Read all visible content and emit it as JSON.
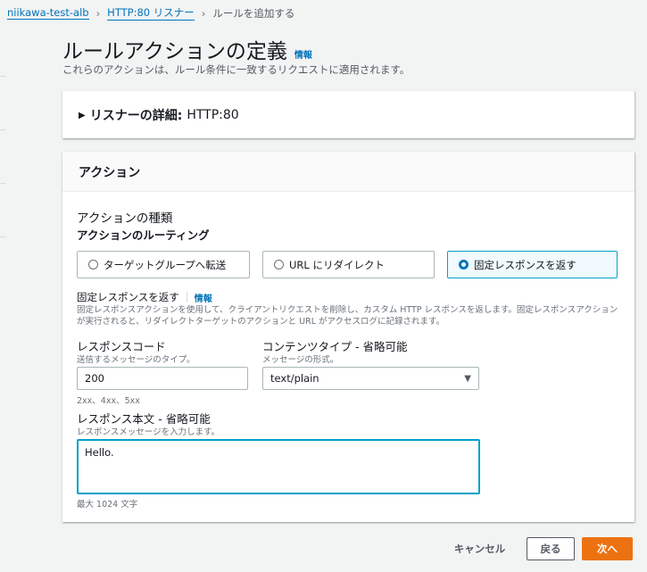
{
  "breadcrumb": [
    "niikawa-test-alb",
    "HTTP:80 リスナー",
    "ルールを追加する"
  ],
  "header": {
    "title": "ルールアクションの定義",
    "info": "情報",
    "subtitle": "これらのアクションは、ルール条件に一致するリクエストに適用されます。"
  },
  "listener_panel": {
    "label": "リスナーの詳細:",
    "value": "HTTP:80"
  },
  "action_panel": {
    "title": "アクション",
    "type_label": "アクションの種類",
    "routing_label": "アクションのルーティング",
    "options": [
      {
        "label": "ターゲットグループへ転送",
        "selected": false
      },
      {
        "label": "URL にリダイレクト",
        "selected": false
      },
      {
        "label": "固定レスポンスを返す",
        "selected": true
      }
    ],
    "fixed": {
      "title": "固定レスポンスを返す",
      "info": "情報",
      "description": "固定レスポンスアクションを使用して、クライアントリクエストを削除し、カスタム HTTP レスポンスを返します。固定レスポンスアクションが実行されると、リダイレクトターゲットのアクションと URL がアクセスログに記録されます。"
    },
    "response_code": {
      "label": "レスポンスコード",
      "sub": "送信するメッセージのタイプ。",
      "value": "200",
      "hint": "2xx、4xx、5xx"
    },
    "content_type": {
      "label": "コンテンツタイプ - 省略可能",
      "sub": "メッセージの形式。",
      "value": "text/plain"
    },
    "body": {
      "label": "レスポンス本文 - 省略可能",
      "sub": "レスポンスメッセージを入力します。",
      "value": "Hello.",
      "hint": "最大 1024 文字"
    }
  },
  "footer": {
    "cancel": "キャンセル",
    "back": "戻る",
    "next": "次へ"
  },
  "colors": {
    "accent": "#0073bb",
    "primary": "#ec7211"
  }
}
